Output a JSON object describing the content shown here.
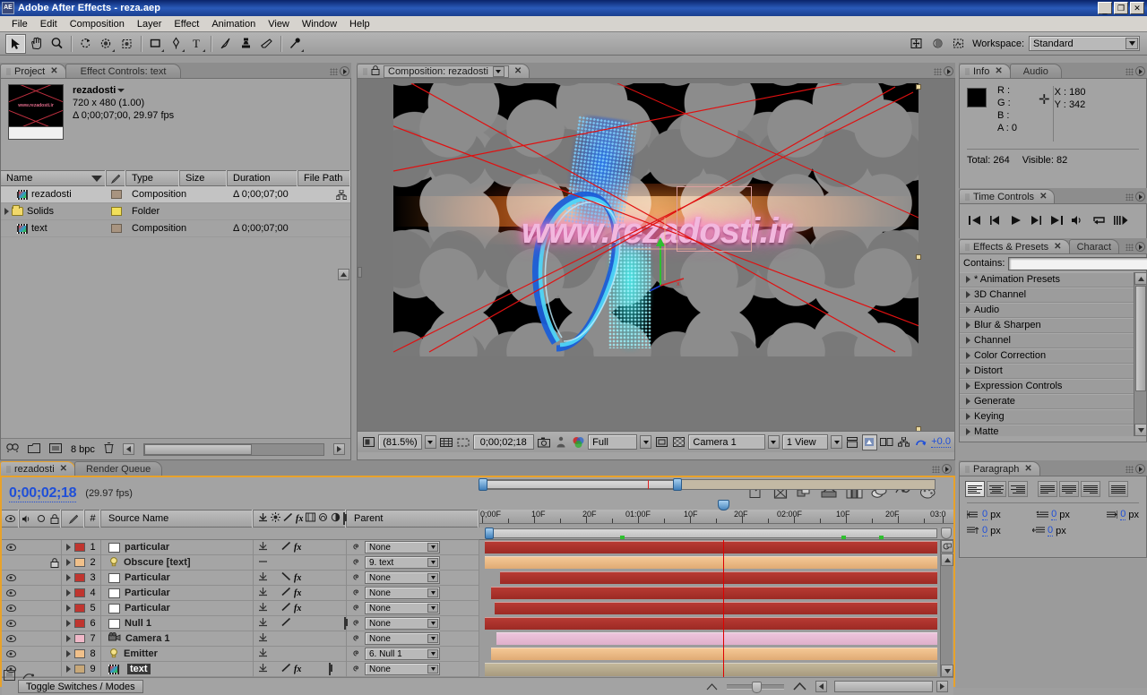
{
  "window": {
    "title": "Adobe After Effects - reza.aep",
    "app_icon": "AE",
    "buttons": {
      "minimize": "_",
      "restore": "❐",
      "close": "✕"
    }
  },
  "menu": {
    "items": [
      "File",
      "Edit",
      "Composition",
      "Layer",
      "Effect",
      "Animation",
      "View",
      "Window",
      "Help"
    ]
  },
  "toolbar": {
    "workspace_label": "Workspace:",
    "workspace_value": "Standard",
    "tools": [
      {
        "name": "selection-tool",
        "icon": "arrow"
      },
      {
        "name": "hand-tool",
        "icon": "hand"
      },
      {
        "name": "zoom-tool",
        "icon": "magnifier"
      },
      {
        "name": "rotation-tool",
        "icon": "rotate"
      },
      {
        "name": "orbit-camera-tool",
        "icon": "orbit"
      },
      {
        "name": "pan-behind-tool",
        "icon": "pan-behind"
      },
      {
        "name": "shape-tool",
        "icon": "rectangle"
      },
      {
        "name": "pen-tool",
        "icon": "pen"
      },
      {
        "name": "type-tool",
        "icon": "T"
      },
      {
        "name": "brush-tool",
        "icon": "brush"
      },
      {
        "name": "clone-stamp-tool",
        "icon": "stamp"
      },
      {
        "name": "eraser-tool",
        "icon": "eraser"
      },
      {
        "name": "puppet-pin-tool",
        "icon": "pin"
      },
      {
        "name": "axis-tool",
        "icon": "axis"
      },
      {
        "name": "mask-tool",
        "icon": "sphere"
      },
      {
        "name": "snapshot-tool",
        "icon": "snapshot"
      }
    ]
  },
  "project_panel": {
    "tabs": [
      {
        "label": "Project",
        "active": true,
        "closable": true
      },
      {
        "label": "Effect Controls: text",
        "active": false,
        "closable": false
      }
    ],
    "item": {
      "name": "rezadosti",
      "dimensions": "720 x 480 (1.00)",
      "duration": "Δ 0;00;07;00, 29.97 fps",
      "thumb_text": "www.rezadosti.ir"
    },
    "columns": [
      "Name",
      "Type",
      "Size",
      "Duration",
      "File Path"
    ],
    "rows": [
      {
        "name": "rezadosti",
        "type": "Composition",
        "size": "",
        "duration": "Δ 0;00;07;00",
        "icon": "composition-icon",
        "selected": true
      },
      {
        "name": "Solids",
        "type": "Folder",
        "size": "",
        "duration": "",
        "icon": "folder-icon",
        "selected": false
      },
      {
        "name": "text",
        "type": "Composition",
        "size": "",
        "duration": "Δ 0;00;07;00",
        "icon": "composition-icon",
        "selected": false
      }
    ],
    "footer": {
      "bpc": "8 bpc"
    }
  },
  "comp_panel": {
    "tab_label": "Composition: rezadosti",
    "viewer_text": "www.rezadosti.ir",
    "controls": {
      "magnification": "(81.5%)",
      "time": "0;00;02;18",
      "resolution": "Full",
      "camera": "Camera 1",
      "view": "1 View",
      "exposure": "+0.0"
    }
  },
  "info_panel": {
    "tabs": [
      {
        "label": "Info",
        "active": true,
        "closable": true
      },
      {
        "label": "Audio",
        "active": false,
        "closable": false
      }
    ],
    "r_label": "R :",
    "r_value": "",
    "g_label": "G :",
    "g_value": "",
    "b_label": "B :",
    "b_value": "",
    "a_label": "A :",
    "a_value": "0",
    "x_label": "X :",
    "x_value": "180",
    "y_label": "Y :",
    "y_value": "342",
    "total_label": "Total:",
    "total_value": "264",
    "visible_label": "Visible:",
    "visible_value": "82",
    "swatch_color": "#000000"
  },
  "time_controls": {
    "tab_label": "Time Controls",
    "buttons": [
      "first-frame",
      "prev-frame",
      "play",
      "next-frame",
      "last-frame",
      "audio",
      "loop",
      "ram-preview"
    ]
  },
  "effects_panel": {
    "tabs": [
      {
        "label": "Effects & Presets",
        "active": true,
        "closable": true
      },
      {
        "label": "Charact",
        "active": false,
        "closable": false
      }
    ],
    "contains_label": "Contains:",
    "contains_value": "",
    "categories": [
      "* Animation Presets",
      "3D Channel",
      "Audio",
      "Blur & Sharpen",
      "Channel",
      "Color Correction",
      "Distort",
      "Expression Controls",
      "Generate",
      "Keying",
      "Matte"
    ]
  },
  "paragraph_panel": {
    "tab_label": "Paragraph",
    "align_buttons": [
      "align-left",
      "align-center",
      "align-right",
      "justify-last-left",
      "justify-last-center",
      "justify-last-right",
      "justify-all"
    ],
    "fields": [
      {
        "name": "indent-left",
        "value": "0",
        "unit": "px"
      },
      {
        "name": "indent-right",
        "value": "0",
        "unit": "px"
      },
      {
        "name": "first-line-indent",
        "value": "0",
        "unit": "px"
      },
      {
        "name": "space-before",
        "value": "0",
        "unit": "px"
      },
      {
        "name": "space-after",
        "value": "0",
        "unit": "px"
      }
    ]
  },
  "timeline": {
    "tabs": [
      {
        "label": "rezadosti",
        "active": true,
        "closable": true
      },
      {
        "label": "Render Queue",
        "active": false,
        "closable": false
      }
    ],
    "current_time": "0;00;02;18",
    "fps": "(29.97 fps)",
    "columns": [
      "#",
      "Source Name",
      "Parent"
    ],
    "toggle_button": "Toggle Switches / Modes",
    "ruler_labels": [
      "0;00F",
      "10F",
      "20F",
      "01:00F",
      "10F",
      "20F",
      "02:00F",
      "10F",
      "20F",
      "03:0"
    ],
    "layers": [
      {
        "index": "1",
        "name": "particular",
        "parent": "None",
        "color": "#c0352f",
        "type": "solid",
        "video": true,
        "locked": false,
        "selected": false,
        "bar_start": 0,
        "bar_end": 100,
        "shy": false,
        "motion_blur": false,
        "has_fx": true,
        "collapse": true,
        "threeD": false
      },
      {
        "index": "2",
        "name": "Obscure [text]",
        "parent": "9. text",
        "color": "#f0c08a",
        "type": "light",
        "video": false,
        "locked": true,
        "selected": false,
        "bar_start": 0,
        "bar_end": 100,
        "has_fx": false,
        "collapse": false,
        "threeD": false
      },
      {
        "index": "3",
        "name": "Particular",
        "parent": "None",
        "color": "#c0352f",
        "type": "solid",
        "video": true,
        "locked": false,
        "selected": false,
        "bar_start": 3,
        "bar_end": 100,
        "has_fx": true,
        "collapse": true,
        "threeD": false
      },
      {
        "index": "4",
        "name": "Particular",
        "parent": "None",
        "color": "#c0352f",
        "type": "solid",
        "video": true,
        "locked": false,
        "selected": false,
        "bar_start": 1,
        "bar_end": 100,
        "has_fx": true,
        "collapse": true,
        "threeD": false
      },
      {
        "index": "5",
        "name": "Particular",
        "parent": "None",
        "color": "#c0352f",
        "type": "solid",
        "video": true,
        "locked": false,
        "selected": false,
        "bar_start": 2,
        "bar_end": 100,
        "has_fx": true,
        "collapse": true,
        "threeD": false
      },
      {
        "index": "6",
        "name": "Null 1",
        "parent": "None",
        "color": "#c0352f",
        "type": "solid",
        "video": true,
        "locked": false,
        "selected": false,
        "bar_start": 0,
        "bar_end": 100,
        "has_fx": false,
        "collapse": true,
        "threeD": true
      },
      {
        "index": "7",
        "name": "Camera 1",
        "parent": "None",
        "color": "#f0b8c8",
        "type": "camera",
        "video": true,
        "locked": false,
        "selected": false,
        "bar_start": 2,
        "bar_end": 100,
        "has_fx": false,
        "collapse": false,
        "threeD": false
      },
      {
        "index": "8",
        "name": "Emitter",
        "parent": "6. Null 1",
        "color": "#f0c08a",
        "type": "light",
        "video": true,
        "locked": false,
        "selected": false,
        "bar_start": 1,
        "bar_end": 100,
        "has_fx": false,
        "collapse": false,
        "threeD": false
      },
      {
        "index": "9",
        "name": "text",
        "parent": "None",
        "color": "#c8a878",
        "type": "composition",
        "video": true,
        "locked": false,
        "selected": true,
        "bar_start": 0,
        "bar_end": 100,
        "has_fx": true,
        "collapse": true,
        "threeD": true
      }
    ]
  },
  "colors": {
    "accent": "#e8a22a",
    "panel_bg": "#a3a3a3",
    "title_blue": "#0a246a",
    "cti_red": "#e00000",
    "link_blue": "#1f4fd8"
  }
}
